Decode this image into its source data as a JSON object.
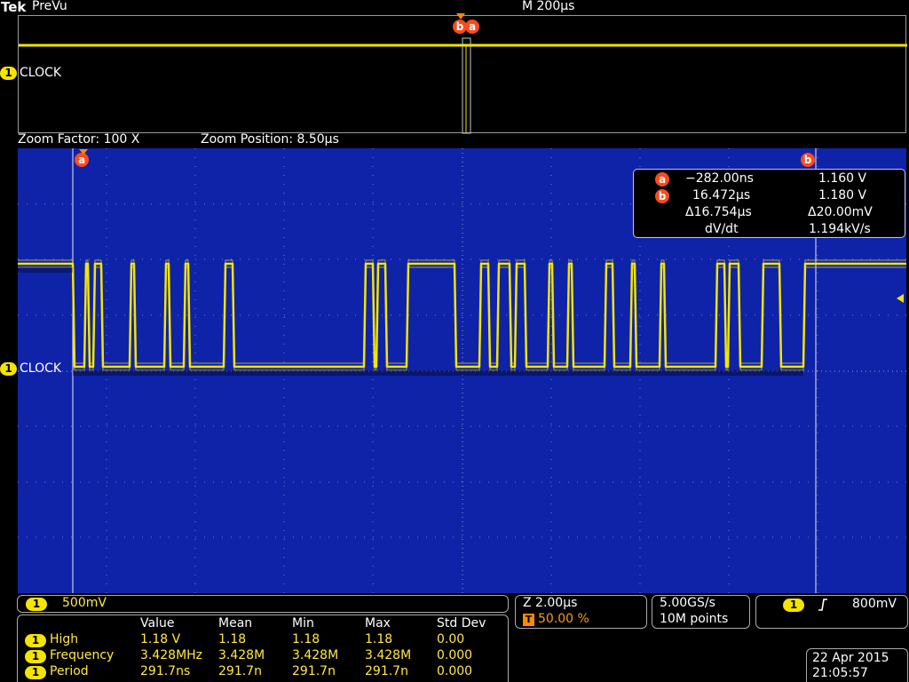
{
  "brand": "Tek",
  "mode": "PreVu",
  "timebase": "M 200µs",
  "channel": {
    "num": "1",
    "label": "CLOCK",
    "scale": "500mV",
    "color": "#f4e400"
  },
  "zoom": {
    "factor": "Zoom Factor: 100 X",
    "position": "Zoom Position: 8.50µs"
  },
  "cursors": {
    "a_label": "a",
    "b_label": "b",
    "a_time": "−282.00ns",
    "a_volt": "1.160 V",
    "b_time": "16.472µs",
    "b_volt": "1.180 V",
    "delta_time": "Δ16.754µs",
    "delta_volt": "Δ20.00mV",
    "dvdt_label": "dV/dt",
    "dvdt_value": "1.194kV/s",
    "color": "#ff4a1c"
  },
  "measurements": {
    "headers": [
      "Value",
      "Mean",
      "Min",
      "Max",
      "Std Dev"
    ],
    "rows": [
      {
        "name": "High",
        "cells": [
          "1.18 V",
          "1.18",
          "1.18",
          "1.18",
          "0.00"
        ]
      },
      {
        "name": "Frequency",
        "cells": [
          "3.428MHz",
          "3.428M",
          "3.428M",
          "3.428M",
          "0.000"
        ]
      },
      {
        "name": "Period",
        "cells": [
          "291.7ns",
          "291.7n",
          "291.7n",
          "291.7n",
          "0.000"
        ]
      }
    ]
  },
  "horizontal": {
    "zoom_scale": "Z 2.00µs",
    "trigger_pos_icon": "T",
    "trigger_pos": "50.00 %"
  },
  "acquisition": {
    "rate": "5.00GS/s",
    "points": "10M points"
  },
  "trigger": {
    "source": "1",
    "slope_icon": "rising-edge-icon",
    "level": "800mV"
  },
  "datetime": {
    "date": "22 Apr 2015",
    "time": "21:05:57"
  },
  "colors": {
    "zoom_bg": "#0f23a8",
    "grid": "#8f9fd6",
    "trace": "#f4e400"
  }
}
